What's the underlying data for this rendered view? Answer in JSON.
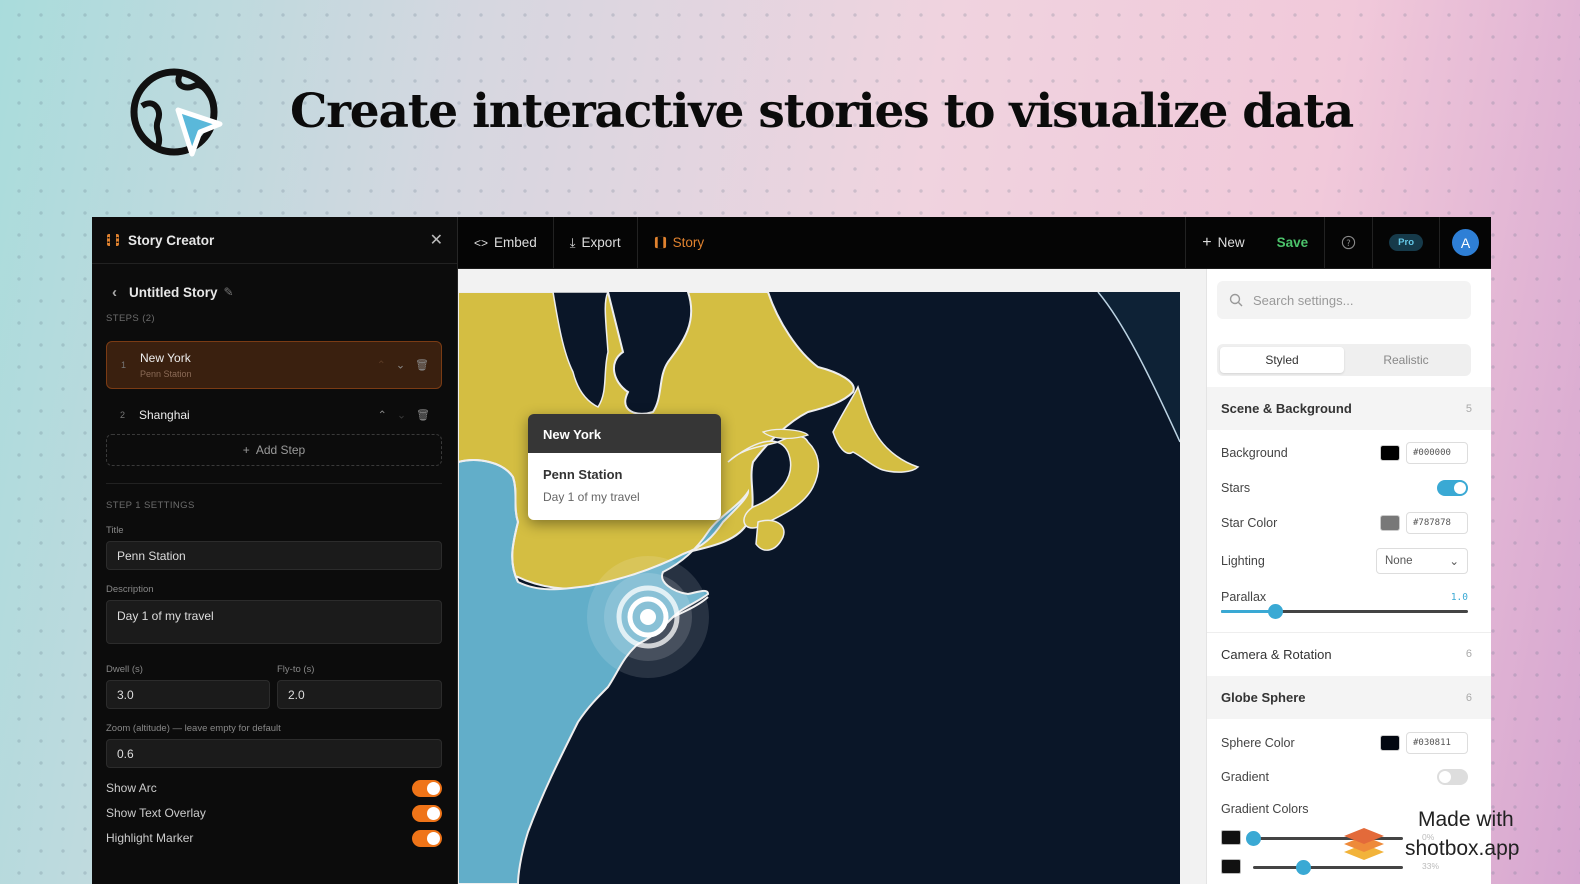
{
  "hero": {
    "title": "Create interactive stories to visualize data",
    "logo_icon": "globe-cursor-icon"
  },
  "left_panel": {
    "header_title": "Story Creator",
    "story_name": "Untitled Story",
    "steps_label": "STEPS (2)",
    "steps": [
      {
        "num": "1",
        "name": "New York",
        "sub": "Penn Station"
      },
      {
        "num": "2",
        "name": "Shanghai",
        "sub": ""
      }
    ],
    "add_step": "Add Step",
    "settings_label": "STEP 1 SETTINGS",
    "title_label": "Title",
    "title_value": "Penn Station",
    "description_label": "Description",
    "description_value": "Day 1 of my travel",
    "dwell_label": "Dwell (s)",
    "dwell_value": "3.0",
    "flyto_label": "Fly-to (s)",
    "flyto_value": "2.0",
    "zoom_label": "Zoom (altitude) — leave empty for default",
    "zoom_value": "0.6",
    "toggles": [
      {
        "label": "Show Arc",
        "on": true
      },
      {
        "label": "Show Text Overlay",
        "on": true
      },
      {
        "label": "Highlight Marker",
        "on": true
      }
    ]
  },
  "topbar": {
    "embed": "Embed",
    "export": "Export",
    "story": "Story",
    "new": "New",
    "save": "Save",
    "badge": "Pro",
    "avatar": "A"
  },
  "globe": {
    "tooltip_title": "New York",
    "tooltip_heading": "Penn Station",
    "tooltip_desc": "Day 1 of my travel"
  },
  "right_panel": {
    "search_placeholder": "Search settings...",
    "modes": [
      "Styled",
      "Realistic"
    ],
    "sections": {
      "scene": {
        "title": "Scene & Background",
        "count": "5"
      },
      "camera": {
        "title": "Camera & Rotation",
        "count": "6"
      },
      "sphere": {
        "title": "Globe Sphere",
        "count": "6"
      }
    },
    "background_label": "Background",
    "background_value": "#000000",
    "stars_label": "Stars",
    "stars_on": true,
    "star_color_label": "Star Color",
    "star_color_value": "#787878",
    "lighting_label": "Lighting",
    "lighting_value": "None",
    "parallax_label": "Parallax",
    "parallax_value": "1.0",
    "parallax_fraction": 0.22,
    "sphere_color_label": "Sphere Color",
    "sphere_color_value": "#030811",
    "gradient_label": "Gradient",
    "gradient_on": false,
    "gradient_colors_label": "Gradient Colors",
    "gradient_stops": [
      {
        "pct": "0%",
        "fraction": 0.0
      },
      {
        "pct": "33%",
        "fraction": 0.33
      }
    ]
  },
  "watermark": {
    "line1": "Made with",
    "line2": "shotbox.app"
  },
  "colors": {
    "accent_orange": "#ef7418",
    "accent_blue": "#3aa9d4",
    "save_green": "#4cc36b",
    "land_yellow": "#d4be42",
    "land_blue": "#62aec9",
    "ocean": "#0a1628"
  }
}
